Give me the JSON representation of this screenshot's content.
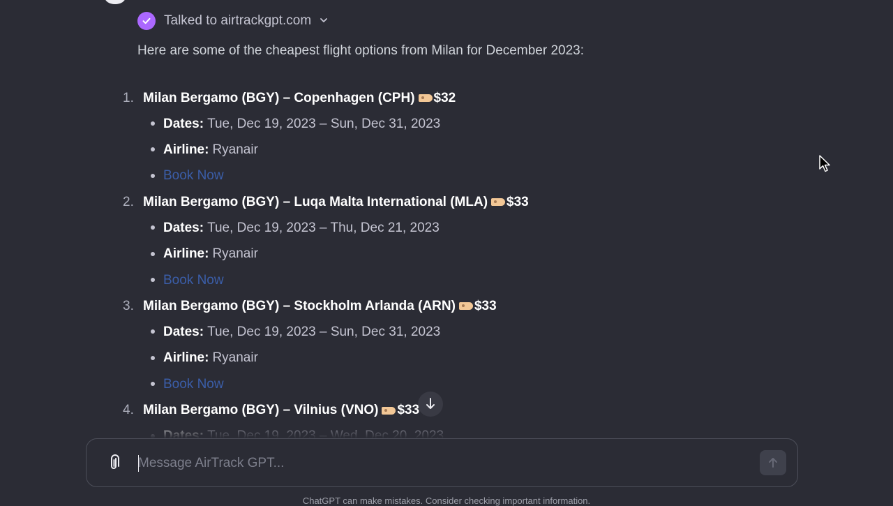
{
  "tool_status": {
    "text": "Talked to airtrackgpt.com",
    "icon": "check-icon",
    "expand_icon": "chevron-down-icon"
  },
  "intro": "Here are some of the cheapest flight options from Milan for December 2023:",
  "labels": {
    "dates": "Dates:",
    "airline": "Airline:",
    "book": "Book Now"
  },
  "flights": [
    {
      "number": "1.",
      "route": "Milan Bergamo (BGY) – Copenhagen (CPH)",
      "price": "$32",
      "dates": "Tue, Dec 19, 2023 – Sun, Dec 31, 2023",
      "airline": "Ryanair"
    },
    {
      "number": "2.",
      "route": "Milan Bergamo (BGY) – Luqa Malta International (MLA)",
      "price": "$33",
      "dates": "Tue, Dec 19, 2023 – Thu, Dec 21, 2023",
      "airline": "Ryanair"
    },
    {
      "number": "3.",
      "route": "Milan Bergamo (BGY) – Stockholm Arlanda (ARN)",
      "price": "$33",
      "dates": "Tue, Dec 19, 2023 – Sun, Dec 31, 2023",
      "airline": "Ryanair"
    },
    {
      "number": "4.",
      "route": "Milan Bergamo (BGY) – Vilnius (VNO)",
      "price": "$33",
      "dates": "Tue, Dec 19, 2023 – Wed, Dec 20, 2023"
    }
  ],
  "composer": {
    "placeholder": "Message AirTrack GPT...",
    "value": ""
  },
  "disclaimer": "ChatGPT can make mistakes. Consider checking important information.",
  "colors": {
    "background": "#2b2c35",
    "accent": "#ab68ff",
    "link": "#3b5ea9",
    "price_tag": "#f2c796"
  }
}
